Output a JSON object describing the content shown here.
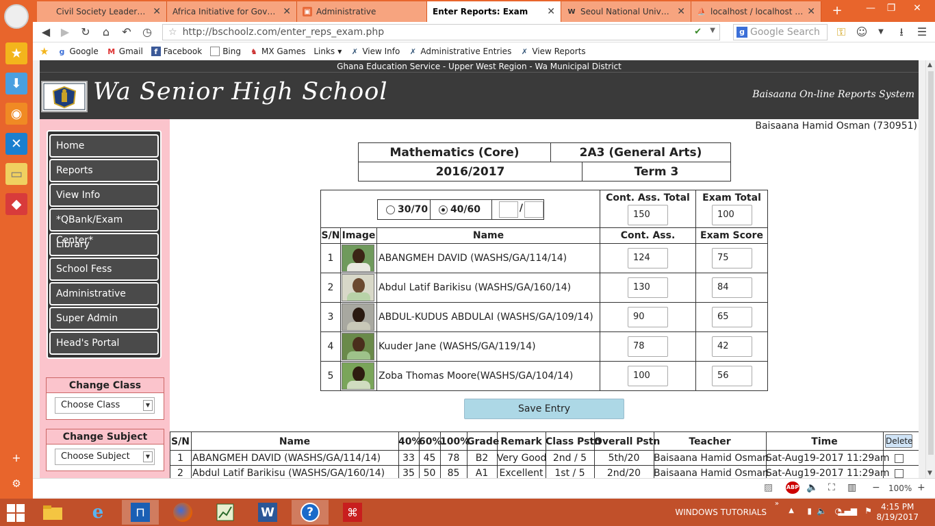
{
  "browser": {
    "tabs": [
      {
        "label": "Civil Society Leadership Aw...",
        "icon": "page-icon"
      },
      {
        "label": "Africa Initiative for Governa...",
        "icon": "page-icon"
      },
      {
        "label": "Administrative",
        "icon": "app-icon"
      },
      {
        "label": "Enter Reports: Exam",
        "icon": "page-icon"
      },
      {
        "label": "Seoul National Universi...",
        "icon": "wikipedia-icon"
      },
      {
        "label": "localhost / localhost / n...",
        "icon": "phpmyadmin-icon"
      }
    ],
    "url": "http://bschoolz.com/enter_reps_exam.php",
    "search_placeholder": "Google Search",
    "search_engine_letter": "g",
    "bookmarks": [
      {
        "label": "Google",
        "icon": "google-icon"
      },
      {
        "label": "Gmail",
        "icon": "gmail-icon"
      },
      {
        "label": "Facebook",
        "icon": "facebook-icon"
      },
      {
        "label": "Bing",
        "icon": "page-icon"
      },
      {
        "label": "MX Games",
        "icon": "games-icon"
      },
      {
        "label": "Links",
        "icon": "folder-icon"
      },
      {
        "label": "View Info",
        "icon": "tools-icon"
      },
      {
        "label": "Administrative Entries",
        "icon": "tools-icon"
      },
      {
        "label": "View Reports",
        "icon": "tools-icon"
      }
    ],
    "zoom": "100%",
    "adblock": "ABP"
  },
  "banner": {
    "district": "Ghana Education Service - Upper West Region - Wa Municipal District",
    "school": "Wa Senior High School",
    "system": "Baisaana On-line Reports System"
  },
  "menu": [
    "Home",
    "Reports",
    "View Info",
    "*QBank/Exam Center*",
    "Library",
    "School Fess",
    "Administrative",
    "Super Admin",
    "Head's Portal"
  ],
  "change_class": {
    "title": "Change Class",
    "value": "Choose Class"
  },
  "change_subject": {
    "title": "Change Subject",
    "value": "Choose Subject"
  },
  "user": "Baisaana Hamid Osman (730951)",
  "header": {
    "subject": "Mathematics (Core)",
    "class": "2A3 (General Arts)",
    "year": "2016/2017",
    "term": "Term 3"
  },
  "entry": {
    "ratio1": "30/70",
    "ratio2": "40/60",
    "slash": "/",
    "ca_total_label": "Cont. Ass. Total",
    "ca_total": "150",
    "exam_total_label": "Exam Total",
    "exam_total": "100",
    "cols": {
      "sn": "S/N",
      "image": "Image",
      "name": "Name",
      "ca": "Cont. Ass.",
      "exam": "Exam Score"
    },
    "rows": [
      {
        "sn": "1",
        "name": "ABANGMEH DAVID (WASHS/GA/114/14)",
        "ca": "124",
        "exam": "75"
      },
      {
        "sn": "2",
        "name": "Abdul Latif Barikisu (WASHS/GA/160/14)",
        "ca": "130",
        "exam": "84"
      },
      {
        "sn": "3",
        "name": "ABDUL-KUDUS ABDULAI (WASHS/GA/109/14)",
        "ca": "90",
        "exam": "65"
      },
      {
        "sn": "4",
        "name": "Kuuder Jane (WASHS/GA/119/14)",
        "ca": "78",
        "exam": "42"
      },
      {
        "sn": "5",
        "name": "Zoba Thomas Moore(WASHS/GA/104/14)",
        "ca": "100",
        "exam": "56"
      }
    ],
    "save": "Save Entry"
  },
  "summary": {
    "cols": [
      "S/N",
      "Name",
      "40%",
      "60%",
      "100%",
      "Grade",
      "Remark",
      "Class Pstn",
      "Overall Pstn",
      "Teacher",
      "Time"
    ],
    "delete": "Delete",
    "rows": [
      [
        "1",
        "ABANGMEH DAVID (WASHS/GA/114/14)",
        "33",
        "45",
        "78",
        "B2",
        "Very Good",
        "2nd / 5",
        "5th/20",
        "Baisaana Hamid Osman",
        "Sat-Aug19-2017 11:29am"
      ],
      [
        "2",
        "Abdul Latif Barikisu (WASHS/GA/160/14)",
        "35",
        "50",
        "85",
        "A1",
        "Excellent",
        "1st / 5",
        "2nd/20",
        "Baisaana Hamid Osman",
        "Sat-Aug19-2017 11:29am"
      ]
    ]
  },
  "taskbar": {
    "tray_label": "WINDOWS TUTORIALS",
    "time": "4:15 PM",
    "date": "8/19/2017"
  }
}
